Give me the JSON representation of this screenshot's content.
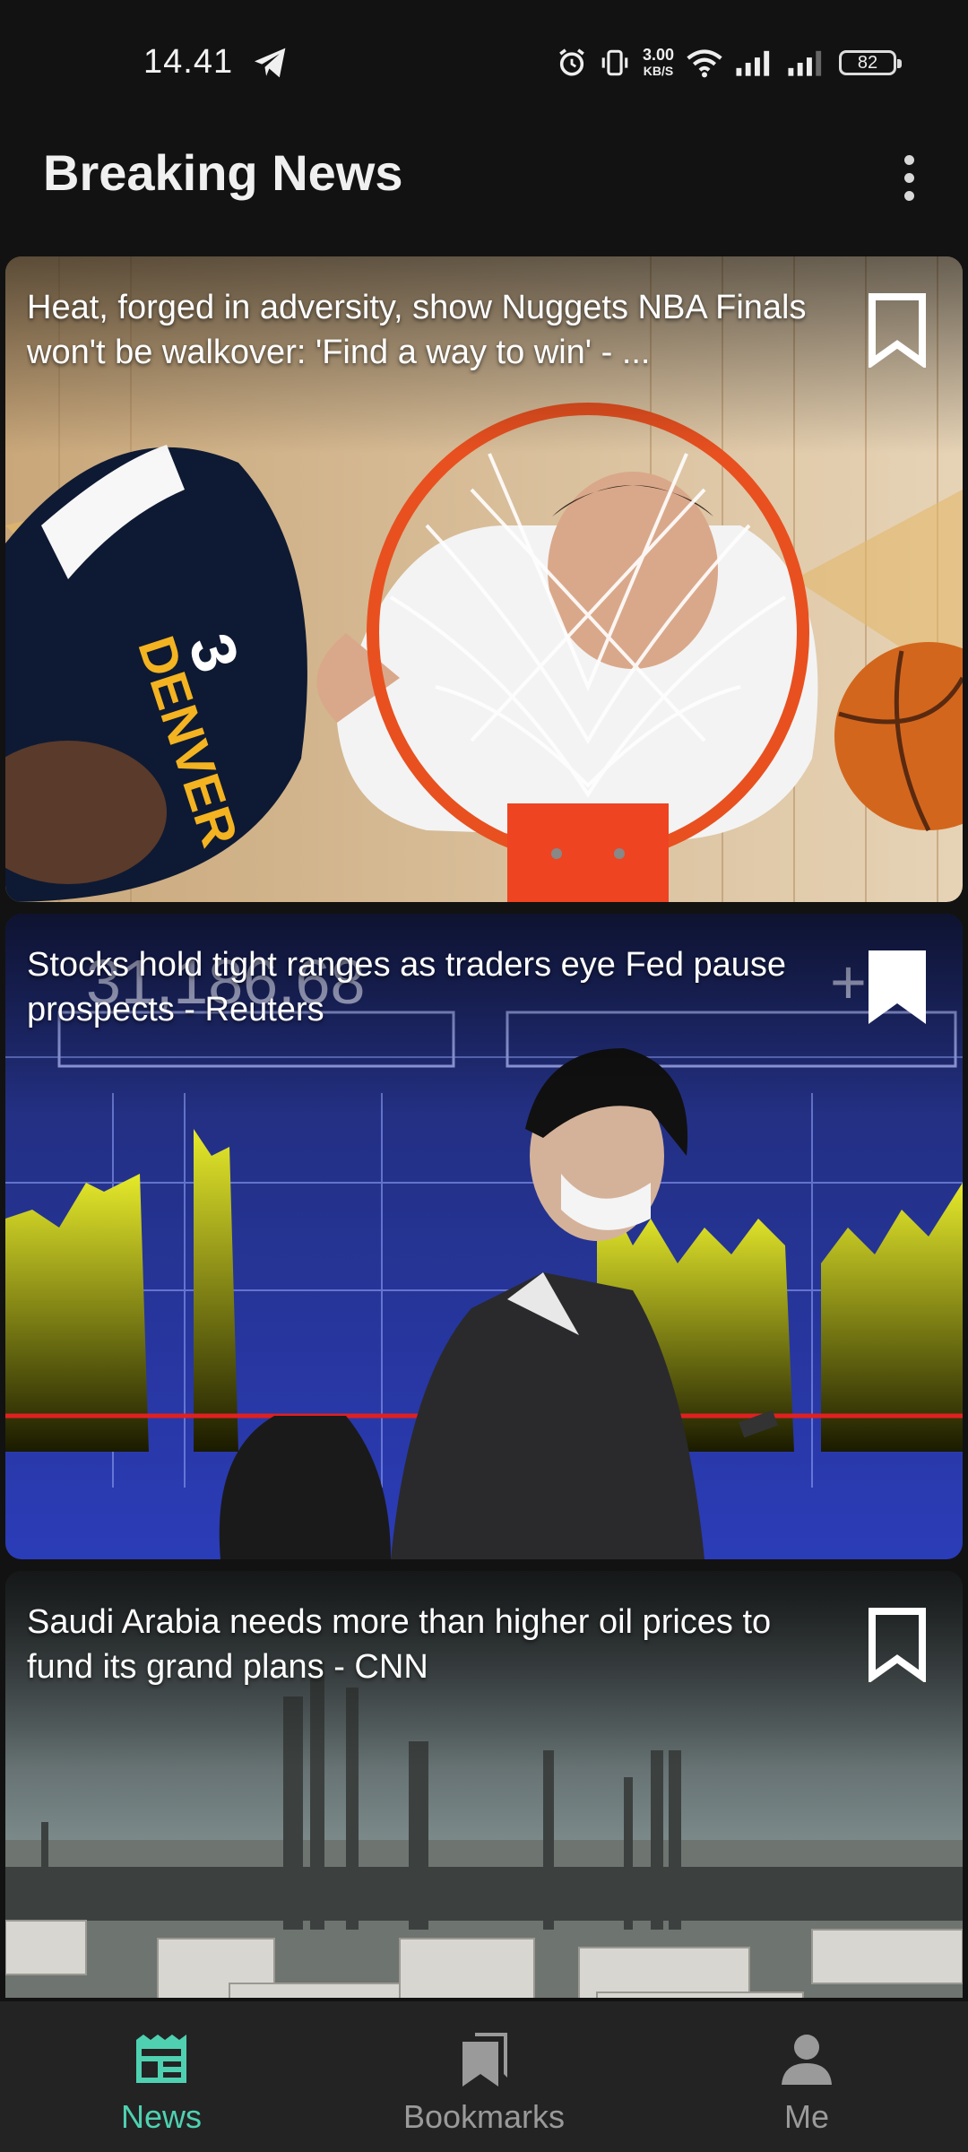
{
  "status_bar": {
    "time": "14.41",
    "net_speed_value": "3.00",
    "net_speed_unit": "KB/S",
    "battery": "82"
  },
  "app_bar": {
    "title": "Breaking News"
  },
  "articles": [
    {
      "title": "Heat, forged in adversity, show Nuggets NBA Finals won't be walkover: 'Find a way to win' - ...",
      "bookmarked": false
    },
    {
      "title": "Stocks hold tight ranges as traders eye Fed pause prospects - Reuters",
      "bookmarked": true
    },
    {
      "title": "Saudi Arabia needs more than higher oil prices to fund its grand plans - CNN",
      "bookmarked": false
    }
  ],
  "bottom_nav": {
    "items": [
      {
        "label": "News",
        "icon": "newspaper-icon",
        "active": true
      },
      {
        "label": "Bookmarks",
        "icon": "bookmarks-icon",
        "active": false
      },
      {
        "label": "Me",
        "icon": "person-icon",
        "active": false
      }
    ]
  },
  "colors": {
    "background": "#121212",
    "accent": "#4fd1b1",
    "nav_background": "#232323",
    "inactive": "#9a9a9a"
  }
}
